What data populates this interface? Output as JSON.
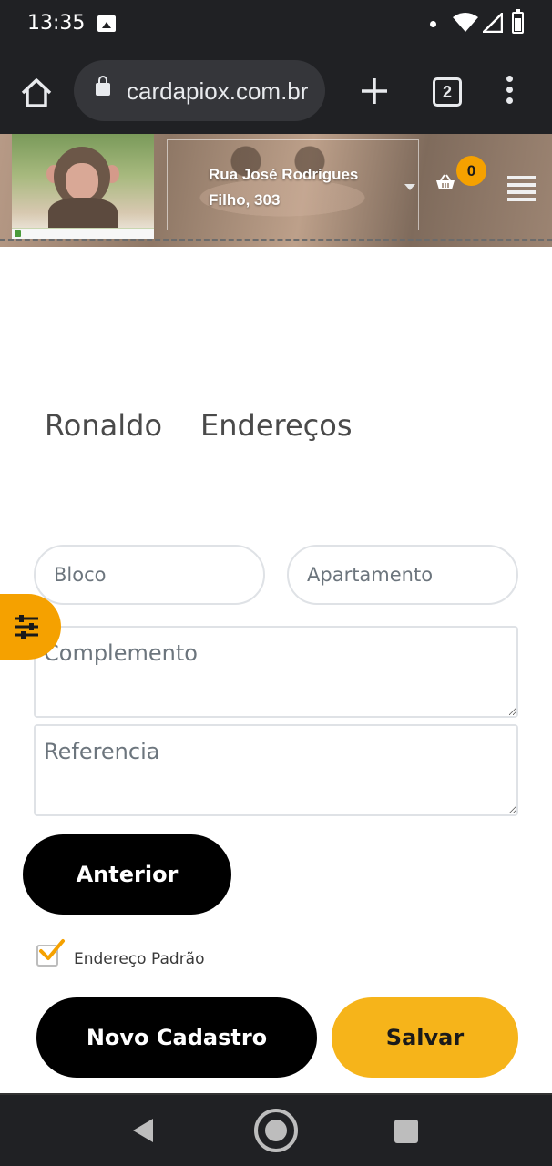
{
  "status_bar": {
    "time": "13:35",
    "icons": [
      "image-icon",
      "notification-dot-icon",
      "wifi-icon",
      "signal-icon",
      "battery-icon"
    ]
  },
  "browser": {
    "url": "cardapiox.com.br",
    "tab_count": "2",
    "icons": [
      "home-icon",
      "lock-icon",
      "plus-icon",
      "tabs-icon",
      "more-vert-icon"
    ]
  },
  "header": {
    "address_line1": "Rua José Rodrigues",
    "address_line2": "Filho, 303",
    "cart_count": "0",
    "icons": [
      "cart-icon",
      "hamburger-icon",
      "chevron-down-icon"
    ]
  },
  "tabs": {
    "name": "Ronaldo",
    "addresses": "Endereços"
  },
  "form": {
    "bloco_placeholder": "Bloco",
    "apartamento_placeholder": "Apartamento",
    "complemento_placeholder": "Complemento",
    "referencia_placeholder": "Referencia",
    "default_address_label": "Endereço Padrão",
    "default_address_checked": true
  },
  "buttons": {
    "previous": "Anterior",
    "new_register": "Novo Cadastro",
    "save": "Salvar"
  },
  "colors": {
    "accent": "#f5a100",
    "save_button": "#f6b41a",
    "primary_button": "#000000",
    "chrome_dark": "#202124"
  }
}
